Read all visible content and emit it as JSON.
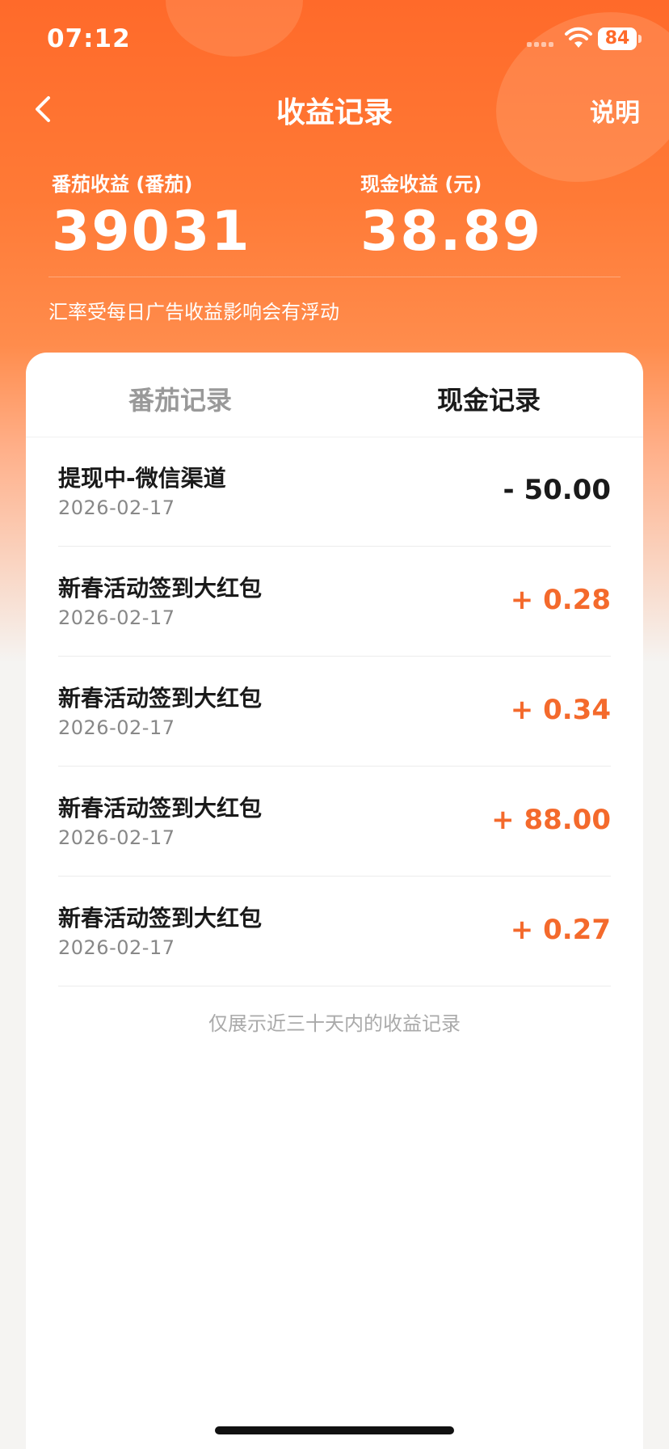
{
  "status_bar": {
    "time": "07:12",
    "battery": "84"
  },
  "nav": {
    "title": "收益记录",
    "help": "说明"
  },
  "stats": [
    {
      "label": "番茄收益 (番茄)",
      "value": "39031"
    },
    {
      "label": "现金收益 (元)",
      "value": "38.89"
    }
  ],
  "note": "汇率受每日广告收益影响会有浮动",
  "tabs": [
    {
      "label": "番茄记录",
      "active": false
    },
    {
      "label": "现金记录",
      "active": true
    }
  ],
  "records": [
    {
      "title": "提现中-微信渠道",
      "date": "2026-02-17",
      "amount": "- 50.00",
      "type": "negative"
    },
    {
      "title": "新春活动签到大红包",
      "date": "2026-02-17",
      "amount": "+ 0.28",
      "type": "positive"
    },
    {
      "title": "新春活动签到大红包",
      "date": "2026-02-17",
      "amount": "+ 0.34",
      "type": "positive"
    },
    {
      "title": "新春活动签到大红包",
      "date": "2026-02-17",
      "amount": "+ 88.00",
      "type": "positive"
    },
    {
      "title": "新春活动签到大红包",
      "date": "2026-02-17",
      "amount": "+ 0.27",
      "type": "positive"
    }
  ],
  "footer_note": "仅展示近三十天内的收益记录",
  "colors": {
    "accent": "#f46a2c",
    "header": "#ff6a2a"
  }
}
